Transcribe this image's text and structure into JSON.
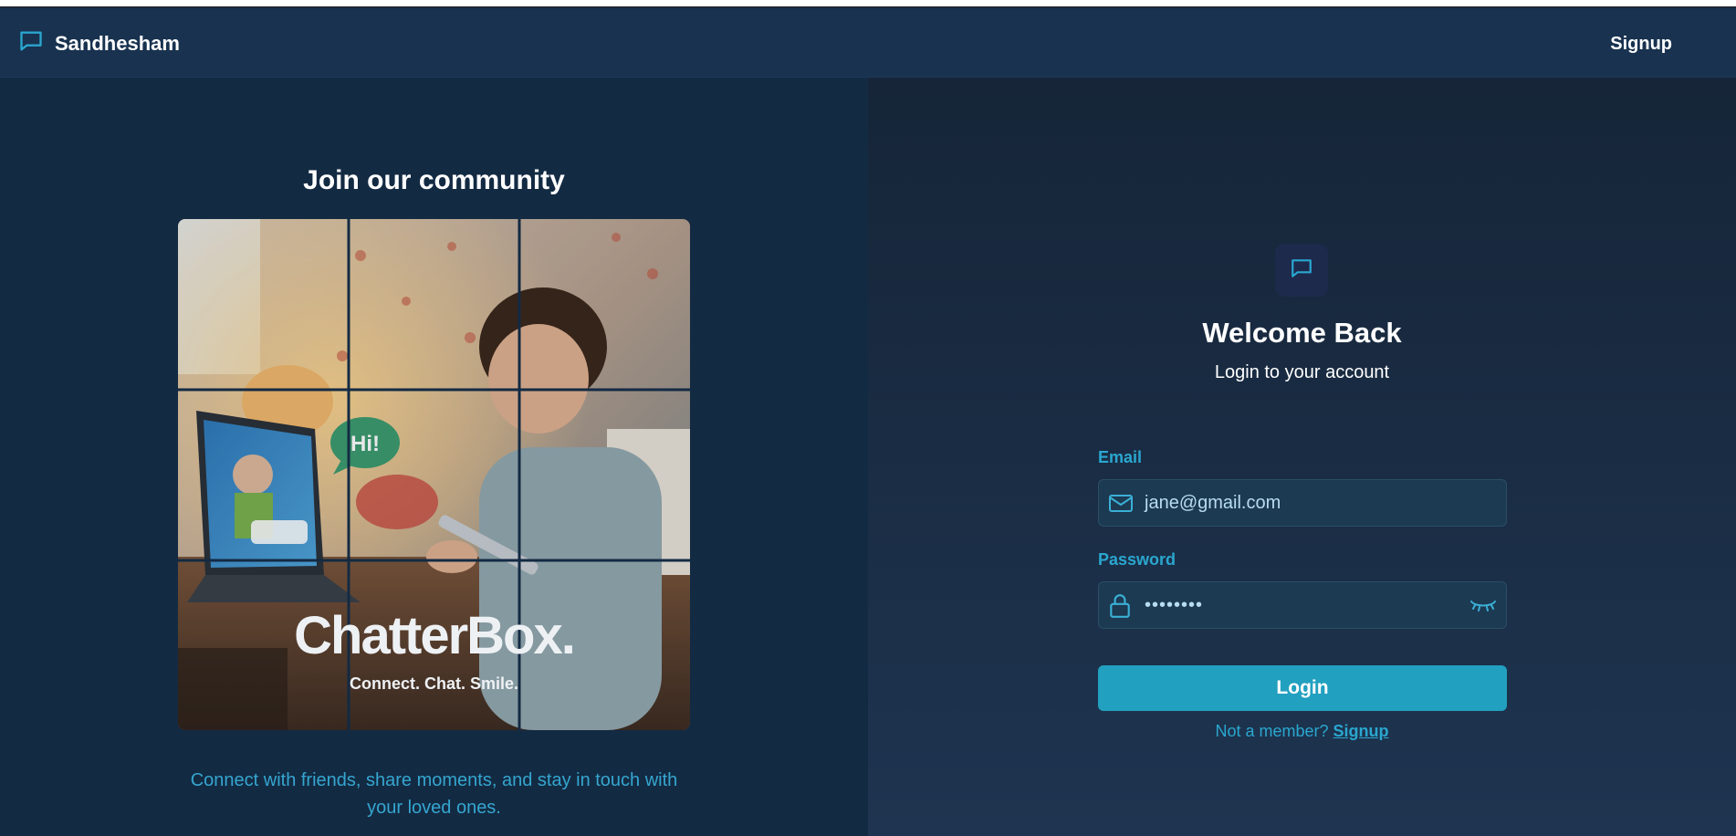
{
  "header": {
    "brand": "Sandhesham",
    "brand_icon": "chat-bubble-icon",
    "signup_label": "Signup"
  },
  "left_panel": {
    "title": "Join our community",
    "image_logo": "ChatterBox.",
    "image_tagline": "Connect. Chat. Smile.",
    "image_bubble": "Hi!",
    "description": "Connect with friends, share moments, and stay in touch with your loved ones."
  },
  "login": {
    "icon": "chat-bubble-icon",
    "title": "Welcome Back",
    "subtitle": "Login to your account",
    "email_label": "Email",
    "email_value": "jane@gmail.com",
    "password_label": "Password",
    "password_value": "••••••••",
    "button_label": "Login",
    "member_text": "Not a member?",
    "member_link": "Signup"
  },
  "colors": {
    "accent": "#22a0c0",
    "navbar": "#18324f",
    "panel": "#132a43"
  }
}
